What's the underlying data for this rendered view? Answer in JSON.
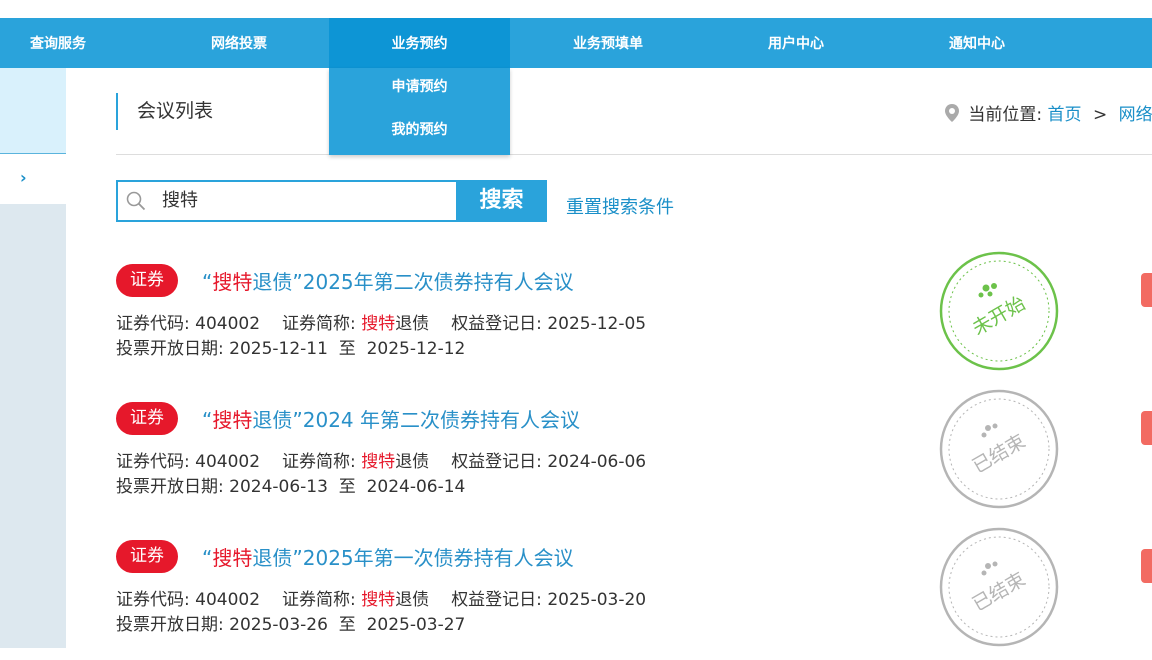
{
  "nav": {
    "items": [
      {
        "label": "查询服务"
      },
      {
        "label": "网络投票"
      },
      {
        "label": "业务预约"
      },
      {
        "label": "业务预填单"
      },
      {
        "label": "用户中心"
      },
      {
        "label": "通知中心"
      }
    ],
    "dropdown": [
      {
        "label": "申请预约"
      },
      {
        "label": "我的预约"
      }
    ]
  },
  "sidebar": {
    "toggle_icon": "chevron-right-icon",
    "toggle_glyph": "›"
  },
  "page": {
    "title": "会议列表"
  },
  "breadcrumb": {
    "prefix": "当前位置:",
    "home": "首页",
    "separator": ">",
    "current": "网络投票"
  },
  "search": {
    "value": "搜特",
    "button_label": "搜索",
    "reset_label": "重置搜索条件"
  },
  "labels": {
    "code": "证券代码:",
    "short_name": "证券简称:",
    "record_date": "权益登记日:",
    "vote_period": "投票开放日期:",
    "to": "至"
  },
  "meetings": [
    {
      "badge": "证券",
      "title_open": "“",
      "title_highlight": "搜特",
      "title_mid": "退债”",
      "title_rest": "2025年第二次债券持有人会议",
      "code": "404002",
      "short_highlight": "搜特",
      "short_rest": "退债",
      "record_date": "2025-12-05",
      "vote_start": "2025-12-11",
      "vote_end": "2025-12-12",
      "status": "未开始",
      "status_color": "#6cc24a"
    },
    {
      "badge": "证券",
      "title_open": "“",
      "title_highlight": "搜特",
      "title_mid": "退债”",
      "title_rest": "2024 年第二次债券持有人会议",
      "code": "404002",
      "short_highlight": "搜特",
      "short_rest": "退债",
      "record_date": "2024-06-06",
      "vote_start": "2024-06-13",
      "vote_end": "2024-06-14",
      "status": "已结束",
      "status_color": "#b5b5b5"
    },
    {
      "badge": "证券",
      "title_open": "“",
      "title_highlight": "搜特",
      "title_mid": "退债”",
      "title_rest": "2025年第一次债券持有人会议",
      "code": "404002",
      "short_highlight": "搜特",
      "short_rest": "退债",
      "record_date": "2025-03-20",
      "vote_start": "2025-03-26",
      "vote_end": "2025-03-27",
      "status": "已结束",
      "status_color": "#b5b5b5"
    }
  ],
  "colors": {
    "nav_bg": "#2aa3db",
    "nav_active": "#0d95d5",
    "badge_red": "#e6182b",
    "link_blue": "#1a8fc8"
  }
}
